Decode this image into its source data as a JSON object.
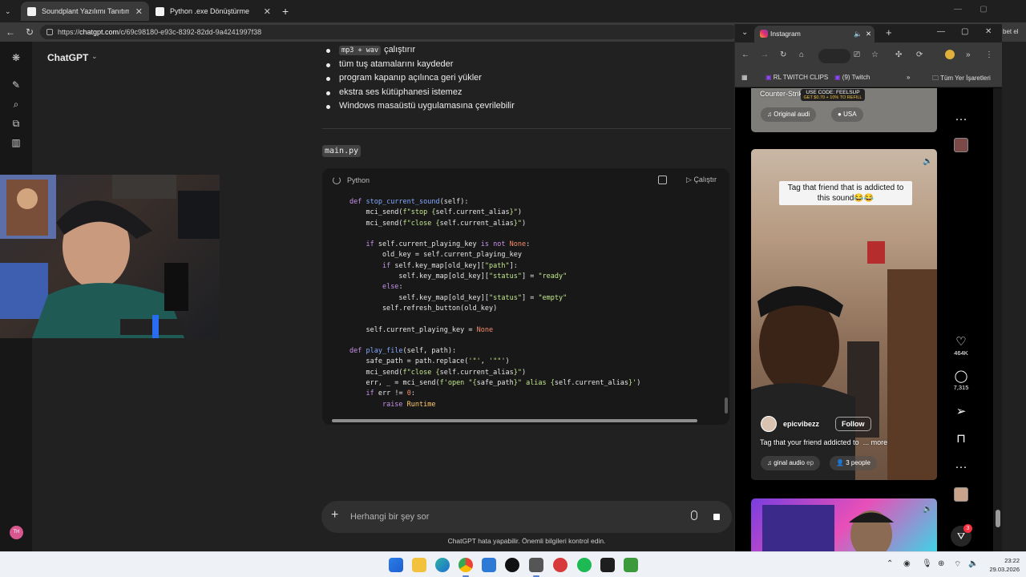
{
  "browser": {
    "tabs": [
      {
        "label": "Soundplant Yazılımı Tanıtımı",
        "active": true
      },
      {
        "label": "Python .exe Dönüştürme",
        "active": false
      }
    ],
    "url_prefix": "https://",
    "url_host": "chatgpt.com",
    "url_path": "/c/69c98180-e93c-8392-82dd-9a4241997f38",
    "right_sliver_text": "bet el"
  },
  "chatgpt": {
    "model_name": "ChatGPT",
    "avatar_initials": "TH",
    "bullets": [
      {
        "code": "mp3 + wav",
        "text": "çalıştırır"
      },
      {
        "code": "",
        "text": "tüm tuş atamalarını kaydeder"
      },
      {
        "code": "",
        "text": "program kapanıp açılınca geri yükler"
      },
      {
        "code": "",
        "text": "ekstra ses kütüphanesi istemez"
      },
      {
        "code": "",
        "text": "Windows masaüstü uygulamasına çevrilebilir"
      }
    ],
    "file_name": "main.py",
    "code_block": {
      "language": "Python",
      "run_label": "Çalıştır"
    },
    "composer_placeholder": "Herhangi bir şey sor",
    "disclaimer": "ChatGPT hata yapabilir. Önemli bilgileri kontrol edin."
  },
  "instagram": {
    "tab_title": "Instagram",
    "bookmarks": [
      "RL TWITCH CLIPS",
      "(9) Twitch",
      "Tüm Yer İşaretleri"
    ],
    "top_reel": {
      "title": "Counter-Strike 2",
      "more": "more",
      "promo_line1": "USE CODE: FEELSUP",
      "promo_line2": "GET $0.70 + 10% TO REFILL",
      "audio": "Original audi",
      "location": "USA"
    },
    "main_reel": {
      "sticker_text": "Tag that friend that is addicted to this sound😂😂",
      "username": "epicvibezz",
      "follow_label": "Follow",
      "caption": "Tag that your friend addicted to",
      "more": "... more",
      "audio": "ginal audio",
      "audio_extra": "ep",
      "people": "3 people",
      "likes": "464K",
      "comments": "7,315"
    },
    "notification_count": "3"
  },
  "taskbar": {
    "time": "23:22",
    "date": "29.03.2026"
  }
}
